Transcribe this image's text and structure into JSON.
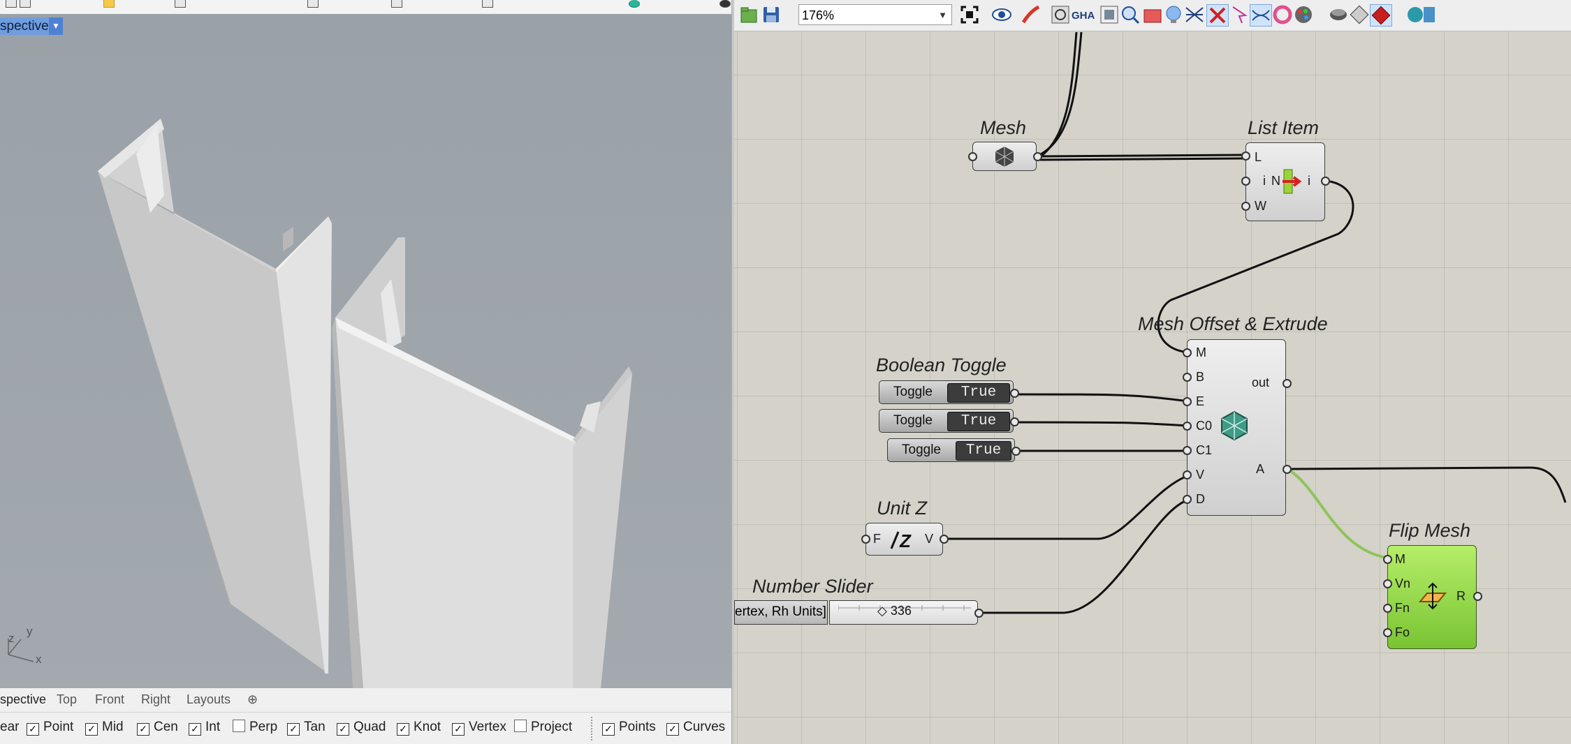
{
  "rhino": {
    "viewport_title": "spective",
    "viewport_tabs": [
      "spective",
      "Top",
      "Front",
      "Right",
      "Layouts"
    ],
    "add_tab_glyph": "⊕",
    "axis_labels": {
      "z": "z",
      "y": "y",
      "x": "x"
    },
    "osnap": [
      {
        "label": "ear",
        "checked": null
      },
      {
        "label": "Point",
        "checked": true
      },
      {
        "label": "Mid",
        "checked": true
      },
      {
        "label": "Cen",
        "checked": true
      },
      {
        "label": "Int",
        "checked": true
      },
      {
        "label": "Perp",
        "checked": false
      },
      {
        "label": "Tan",
        "checked": true
      },
      {
        "label": "Quad",
        "checked": true
      },
      {
        "label": "Knot",
        "checked": true
      },
      {
        "label": "Vertex",
        "checked": true
      },
      {
        "label": "Project",
        "checked": false
      },
      {
        "label": "Points",
        "checked": true
      },
      {
        "label": "Curves",
        "checked": true
      }
    ]
  },
  "grasshopper": {
    "zoom": "176%",
    "toolbar_icons": [
      "open-file-icon",
      "save-icon",
      "zoom-extents-icon",
      "preview-eye-icon",
      "sketch-icon",
      "custom-preview-icon",
      "gha-icon",
      "bake-icon",
      "search-icon",
      "cluster-icon",
      "bubble-icon",
      "wire-display-icon",
      "delete-wires-icon",
      "select-icon",
      "wire-icon",
      "ring-icon",
      "palette-icon",
      "ghost-preview-icon",
      "hidden-preview-icon",
      "selected-preview-icon",
      "extra-icon"
    ],
    "components": {
      "mesh": {
        "nickname": "Mesh"
      },
      "list_item": {
        "nickname": "List Item",
        "inputs": [
          "L",
          "i",
          "W"
        ],
        "outputs": [
          "i"
        ],
        "center": "N"
      },
      "boolean_toggle": {
        "nickname": "Boolean Toggle"
      },
      "toggles": [
        {
          "label": "Toggle",
          "value": "True"
        },
        {
          "label": "Toggle",
          "value": "True"
        },
        {
          "label": "Toggle",
          "value": "True"
        }
      ],
      "offset_extrude": {
        "nickname": "Mesh Offset & Extrude",
        "inputs": [
          "M",
          "B",
          "E",
          "C0",
          "C1",
          "V",
          "D"
        ],
        "outputs": [
          "out",
          "A"
        ]
      },
      "unit_z": {
        "nickname": "Unit Z",
        "inputs": [
          "F"
        ],
        "outputs": [
          "V"
        ]
      },
      "slider": {
        "nickname": "Number Slider",
        "label": "ertex, Rh Units]",
        "value": "◇ 336"
      },
      "flip_mesh": {
        "nickname": "Flip Mesh",
        "inputs": [
          "M",
          "Vn",
          "Fn",
          "Fo"
        ],
        "outputs": [
          "R"
        ]
      }
    }
  },
  "colors": {
    "viewport_bg": "#9ea4aa",
    "gh_canvas": "#d5d2ca",
    "flip_green": "#8ed43f",
    "wire_green": "#8fc45a",
    "tab_blue": "#6f9de0"
  }
}
